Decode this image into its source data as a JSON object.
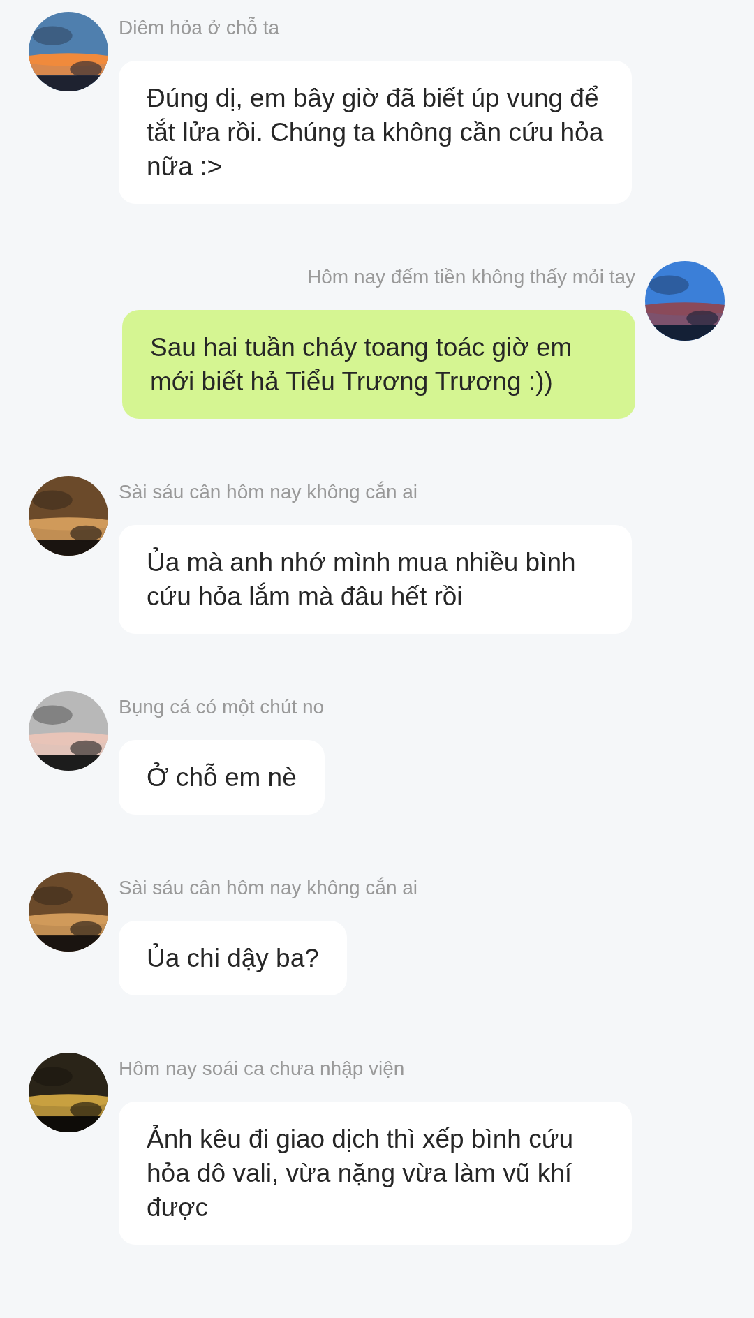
{
  "messages": [
    {
      "kind": "received",
      "sender": "Diêm hỏa ở chỗ ta",
      "text": "Đúng dị, em bây giờ đã biết úp vung để tắt lửa rồi. Chúng ta không cần cứu hỏa nữa :>"
    },
    {
      "kind": "sent",
      "sender": "Hôm nay đếm tiền không thấy mỏi tay",
      "text": "Sau hai tuần cháy toang toác giờ em mới biết hả Tiểu Trương Trương :))"
    },
    {
      "kind": "received",
      "sender": "Sài sáu cân hôm nay không cắn ai",
      "text": "Ủa mà anh nhớ mình mua nhiều bình cứu hỏa lắm mà đâu hết rồi"
    },
    {
      "kind": "received",
      "sender": "Bụng cá có một chút no",
      "text": "Ở chỗ em nè"
    },
    {
      "kind": "received",
      "sender": "Sài sáu cân hôm nay không cắn ai",
      "text": "Ủa chi dậy ba?"
    },
    {
      "kind": "received",
      "sender": "Hôm nay soái ca chưa nhập viện",
      "text": "Ảnh kêu đi giao dịch thì xếp bình cứu hỏa dô vali, vừa nặng vừa làm vũ khí được"
    }
  ]
}
